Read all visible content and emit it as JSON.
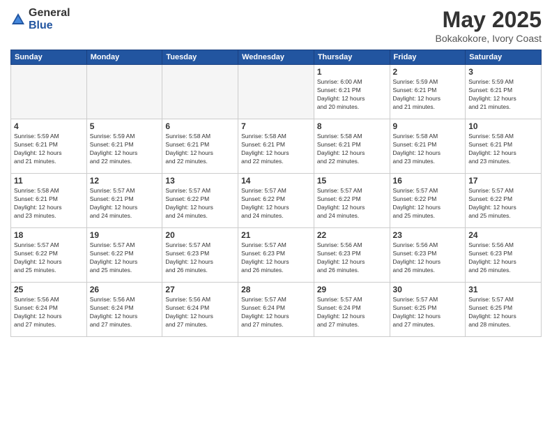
{
  "logo": {
    "general": "General",
    "blue": "Blue"
  },
  "title": "May 2025",
  "location": "Bokakokore, Ivory Coast",
  "days_of_week": [
    "Sunday",
    "Monday",
    "Tuesday",
    "Wednesday",
    "Thursday",
    "Friday",
    "Saturday"
  ],
  "weeks": [
    [
      {
        "day": "",
        "info": ""
      },
      {
        "day": "",
        "info": ""
      },
      {
        "day": "",
        "info": ""
      },
      {
        "day": "",
        "info": ""
      },
      {
        "day": "1",
        "info": "Sunrise: 6:00 AM\nSunset: 6:21 PM\nDaylight: 12 hours\nand 20 minutes."
      },
      {
        "day": "2",
        "info": "Sunrise: 5:59 AM\nSunset: 6:21 PM\nDaylight: 12 hours\nand 21 minutes."
      },
      {
        "day": "3",
        "info": "Sunrise: 5:59 AM\nSunset: 6:21 PM\nDaylight: 12 hours\nand 21 minutes."
      }
    ],
    [
      {
        "day": "4",
        "info": "Sunrise: 5:59 AM\nSunset: 6:21 PM\nDaylight: 12 hours\nand 21 minutes."
      },
      {
        "day": "5",
        "info": "Sunrise: 5:59 AM\nSunset: 6:21 PM\nDaylight: 12 hours\nand 22 minutes."
      },
      {
        "day": "6",
        "info": "Sunrise: 5:58 AM\nSunset: 6:21 PM\nDaylight: 12 hours\nand 22 minutes."
      },
      {
        "day": "7",
        "info": "Sunrise: 5:58 AM\nSunset: 6:21 PM\nDaylight: 12 hours\nand 22 minutes."
      },
      {
        "day": "8",
        "info": "Sunrise: 5:58 AM\nSunset: 6:21 PM\nDaylight: 12 hours\nand 22 minutes."
      },
      {
        "day": "9",
        "info": "Sunrise: 5:58 AM\nSunset: 6:21 PM\nDaylight: 12 hours\nand 23 minutes."
      },
      {
        "day": "10",
        "info": "Sunrise: 5:58 AM\nSunset: 6:21 PM\nDaylight: 12 hours\nand 23 minutes."
      }
    ],
    [
      {
        "day": "11",
        "info": "Sunrise: 5:58 AM\nSunset: 6:21 PM\nDaylight: 12 hours\nand 23 minutes."
      },
      {
        "day": "12",
        "info": "Sunrise: 5:57 AM\nSunset: 6:21 PM\nDaylight: 12 hours\nand 24 minutes."
      },
      {
        "day": "13",
        "info": "Sunrise: 5:57 AM\nSunset: 6:22 PM\nDaylight: 12 hours\nand 24 minutes."
      },
      {
        "day": "14",
        "info": "Sunrise: 5:57 AM\nSunset: 6:22 PM\nDaylight: 12 hours\nand 24 minutes."
      },
      {
        "day": "15",
        "info": "Sunrise: 5:57 AM\nSunset: 6:22 PM\nDaylight: 12 hours\nand 24 minutes."
      },
      {
        "day": "16",
        "info": "Sunrise: 5:57 AM\nSunset: 6:22 PM\nDaylight: 12 hours\nand 25 minutes."
      },
      {
        "day": "17",
        "info": "Sunrise: 5:57 AM\nSunset: 6:22 PM\nDaylight: 12 hours\nand 25 minutes."
      }
    ],
    [
      {
        "day": "18",
        "info": "Sunrise: 5:57 AM\nSunset: 6:22 PM\nDaylight: 12 hours\nand 25 minutes."
      },
      {
        "day": "19",
        "info": "Sunrise: 5:57 AM\nSunset: 6:22 PM\nDaylight: 12 hours\nand 25 minutes."
      },
      {
        "day": "20",
        "info": "Sunrise: 5:57 AM\nSunset: 6:23 PM\nDaylight: 12 hours\nand 26 minutes."
      },
      {
        "day": "21",
        "info": "Sunrise: 5:57 AM\nSunset: 6:23 PM\nDaylight: 12 hours\nand 26 minutes."
      },
      {
        "day": "22",
        "info": "Sunrise: 5:56 AM\nSunset: 6:23 PM\nDaylight: 12 hours\nand 26 minutes."
      },
      {
        "day": "23",
        "info": "Sunrise: 5:56 AM\nSunset: 6:23 PM\nDaylight: 12 hours\nand 26 minutes."
      },
      {
        "day": "24",
        "info": "Sunrise: 5:56 AM\nSunset: 6:23 PM\nDaylight: 12 hours\nand 26 minutes."
      }
    ],
    [
      {
        "day": "25",
        "info": "Sunrise: 5:56 AM\nSunset: 6:24 PM\nDaylight: 12 hours\nand 27 minutes."
      },
      {
        "day": "26",
        "info": "Sunrise: 5:56 AM\nSunset: 6:24 PM\nDaylight: 12 hours\nand 27 minutes."
      },
      {
        "day": "27",
        "info": "Sunrise: 5:56 AM\nSunset: 6:24 PM\nDaylight: 12 hours\nand 27 minutes."
      },
      {
        "day": "28",
        "info": "Sunrise: 5:57 AM\nSunset: 6:24 PM\nDaylight: 12 hours\nand 27 minutes."
      },
      {
        "day": "29",
        "info": "Sunrise: 5:57 AM\nSunset: 6:24 PM\nDaylight: 12 hours\nand 27 minutes."
      },
      {
        "day": "30",
        "info": "Sunrise: 5:57 AM\nSunset: 6:25 PM\nDaylight: 12 hours\nand 27 minutes."
      },
      {
        "day": "31",
        "info": "Sunrise: 5:57 AM\nSunset: 6:25 PM\nDaylight: 12 hours\nand 28 minutes."
      }
    ]
  ]
}
